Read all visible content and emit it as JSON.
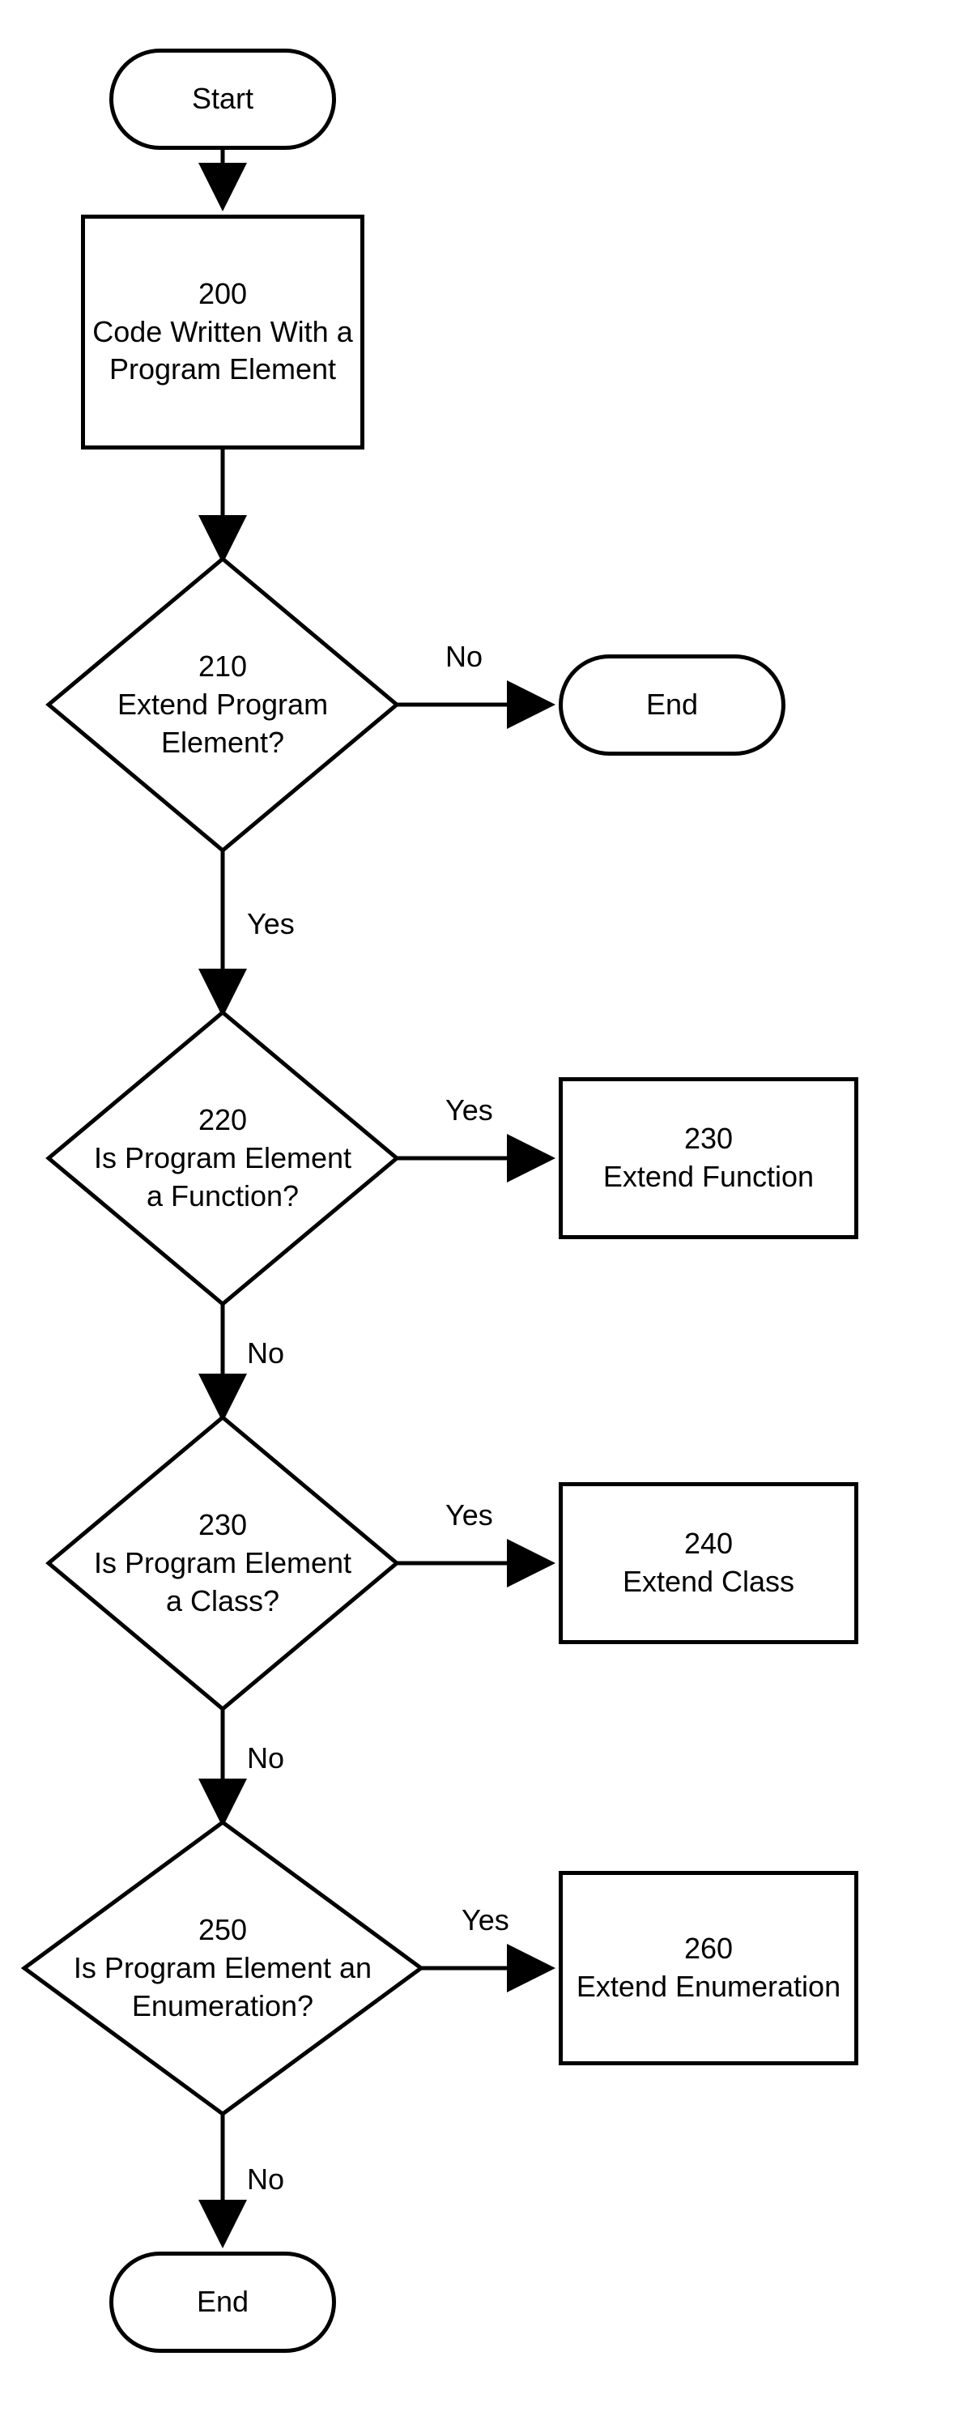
{
  "chart_data": {
    "type": "flowchart",
    "nodes": [
      {
        "id": "start",
        "kind": "terminator",
        "label": "Start"
      },
      {
        "id": "n200",
        "kind": "process",
        "ref": "200",
        "label": "Code Written With a Program Element"
      },
      {
        "id": "d210",
        "kind": "decision",
        "ref": "210",
        "label": "Extend Program Element?"
      },
      {
        "id": "end1",
        "kind": "terminator",
        "label": "End"
      },
      {
        "id": "d220",
        "kind": "decision",
        "ref": "220",
        "label": "Is Program Element a Function?"
      },
      {
        "id": "n230r",
        "kind": "process",
        "ref": "230",
        "label": "Extend Function"
      },
      {
        "id": "d230",
        "kind": "decision",
        "ref": "230",
        "label": "Is Program Element a Class?"
      },
      {
        "id": "n240",
        "kind": "process",
        "ref": "240",
        "label": "Extend Class"
      },
      {
        "id": "d250",
        "kind": "decision",
        "ref": "250",
        "label": "Is Program Element an Enumeration?"
      },
      {
        "id": "n260",
        "kind": "process",
        "ref": "260",
        "label": "Extend Enumeration"
      },
      {
        "id": "end2",
        "kind": "terminator",
        "label": "End"
      }
    ],
    "edges": [
      {
        "from": "start",
        "to": "n200"
      },
      {
        "from": "n200",
        "to": "d210"
      },
      {
        "from": "d210",
        "to": "end1",
        "label": "No"
      },
      {
        "from": "d210",
        "to": "d220",
        "label": "Yes"
      },
      {
        "from": "d220",
        "to": "n230r",
        "label": "Yes"
      },
      {
        "from": "d220",
        "to": "d230",
        "label": "No"
      },
      {
        "from": "d230",
        "to": "n240",
        "label": "Yes"
      },
      {
        "from": "d230",
        "to": "d250",
        "label": "No"
      },
      {
        "from": "d250",
        "to": "n260",
        "label": "Yes"
      },
      {
        "from": "d250",
        "to": "end2",
        "label": "No"
      },
      {
        "from": "n230r",
        "to": "end2",
        "implicit": true
      },
      {
        "from": "n240",
        "to": "end2",
        "implicit": true
      },
      {
        "from": "n260",
        "to": "end2",
        "implicit": true
      }
    ]
  },
  "labels": {
    "start": "Start",
    "end": "End",
    "n200_ref": "200",
    "n200_txt": "Code Written With a Program Element",
    "d210_ref": "210",
    "d210_txt": "Extend Program Element?",
    "d220_ref": "220",
    "d220_txt": "Is Program Element a Function?",
    "n230r_ref": "230",
    "n230r_txt": "Extend Function",
    "d230_ref": "230",
    "d230_txt": "Is Program Element a Class?",
    "n240_ref": "240",
    "n240_txt": "Extend Class",
    "d250_ref": "250",
    "d250_txt": "Is Program Element an Enumeration?",
    "n260_ref": "260",
    "n260_txt": "Extend Enumeration",
    "yes": "Yes",
    "no": "No"
  }
}
